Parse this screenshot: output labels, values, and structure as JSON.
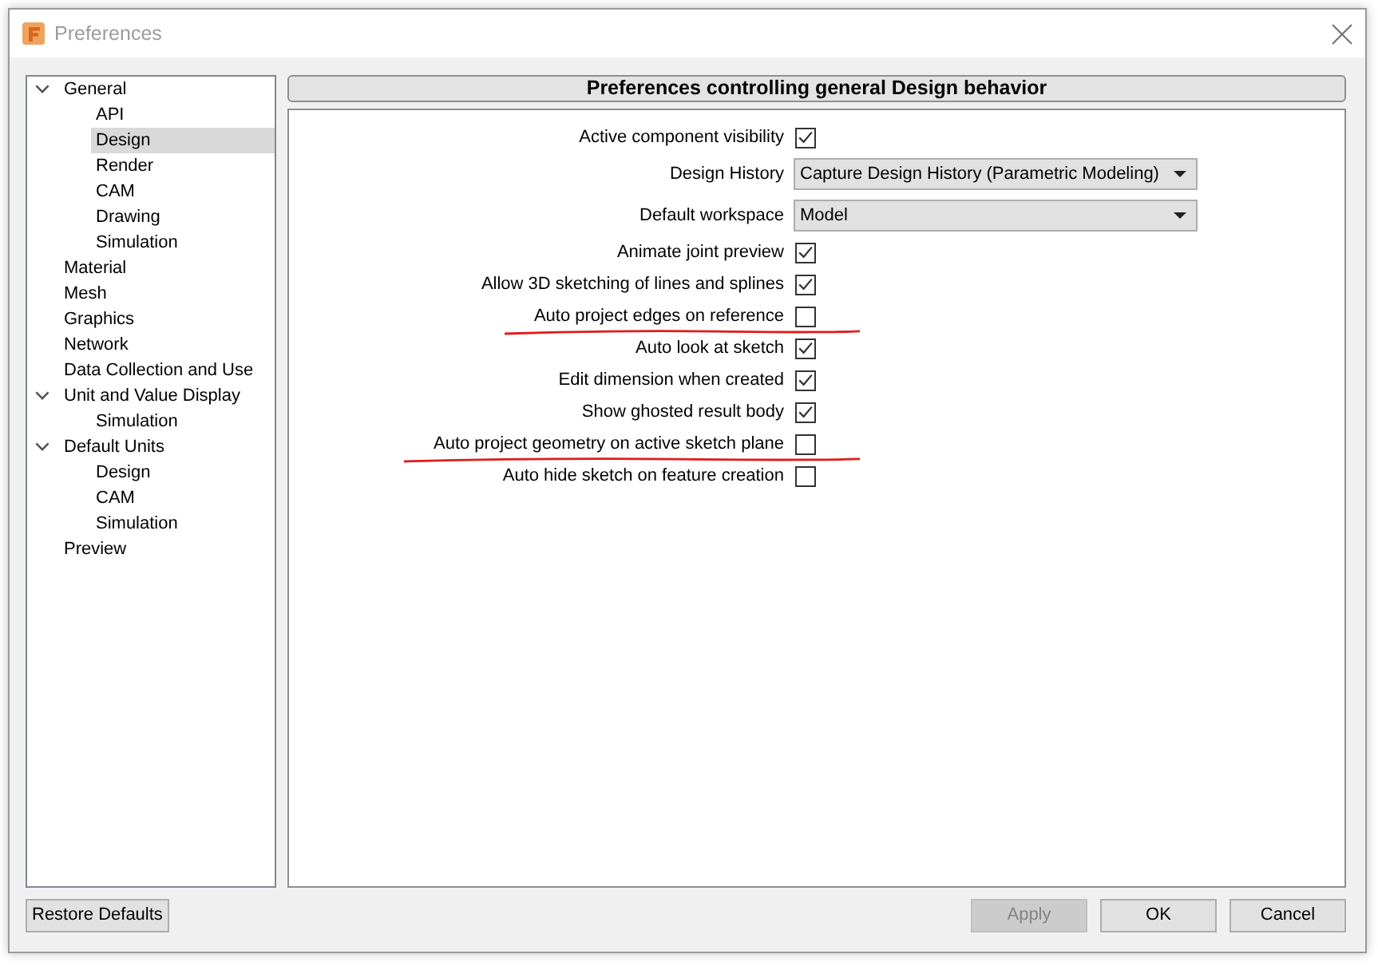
{
  "window": {
    "title": "Preferences"
  },
  "sidebar": {
    "items": [
      {
        "label": "General",
        "expanded": true,
        "selected": false,
        "children": [
          {
            "label": "API",
            "selected": false
          },
          {
            "label": "Design",
            "selected": true
          },
          {
            "label": "Render",
            "selected": false
          },
          {
            "label": "CAM",
            "selected": false
          },
          {
            "label": "Drawing",
            "selected": false
          },
          {
            "label": "Simulation",
            "selected": false
          }
        ]
      },
      {
        "label": "Material",
        "selected": false
      },
      {
        "label": "Mesh",
        "selected": false
      },
      {
        "label": "Graphics",
        "selected": false
      },
      {
        "label": "Network",
        "selected": false
      },
      {
        "label": "Data Collection and Use",
        "selected": false
      },
      {
        "label": "Unit and Value Display",
        "expanded": true,
        "selected": false,
        "children": [
          {
            "label": "Simulation",
            "selected": false
          }
        ]
      },
      {
        "label": "Default Units",
        "expanded": true,
        "selected": false,
        "children": [
          {
            "label": "Design",
            "selected": false
          },
          {
            "label": "CAM",
            "selected": false
          },
          {
            "label": "Simulation",
            "selected": false
          }
        ]
      },
      {
        "label": "Preview",
        "selected": false
      }
    ]
  },
  "panel": {
    "header": "Preferences controlling general Design behavior",
    "options": [
      {
        "kind": "checkbox",
        "label": "Active component visibility",
        "checked": true,
        "annotated": false
      },
      {
        "kind": "dropdown",
        "label": "Design History",
        "value": "Capture Design History (Parametric Modeling)",
        "annotated": false
      },
      {
        "kind": "dropdown",
        "label": "Default workspace",
        "value": "Model",
        "annotated": false
      },
      {
        "kind": "checkbox",
        "label": "Animate joint preview",
        "checked": true,
        "annotated": false
      },
      {
        "kind": "checkbox",
        "label": "Allow 3D sketching of lines and splines",
        "checked": true,
        "annotated": false
      },
      {
        "kind": "checkbox",
        "label": "Auto project edges on reference",
        "checked": false,
        "annotated": true
      },
      {
        "kind": "checkbox",
        "label": "Auto look at sketch",
        "checked": true,
        "annotated": false
      },
      {
        "kind": "checkbox",
        "label": "Edit dimension when created",
        "checked": true,
        "annotated": false
      },
      {
        "kind": "checkbox",
        "label": "Show ghosted result body",
        "checked": true,
        "annotated": false
      },
      {
        "kind": "checkbox",
        "label": "Auto project geometry on active sketch plane",
        "checked": false,
        "annotated": true
      },
      {
        "kind": "checkbox",
        "label": "Auto hide sketch on feature creation",
        "checked": false,
        "annotated": false
      }
    ]
  },
  "footer": {
    "left_buttons": [
      {
        "label": "Restore Defaults",
        "disabled": false
      }
    ],
    "right_buttons": [
      {
        "label": "Apply",
        "disabled": true
      },
      {
        "label": "OK",
        "disabled": false
      },
      {
        "label": "Cancel",
        "disabled": false
      }
    ]
  }
}
